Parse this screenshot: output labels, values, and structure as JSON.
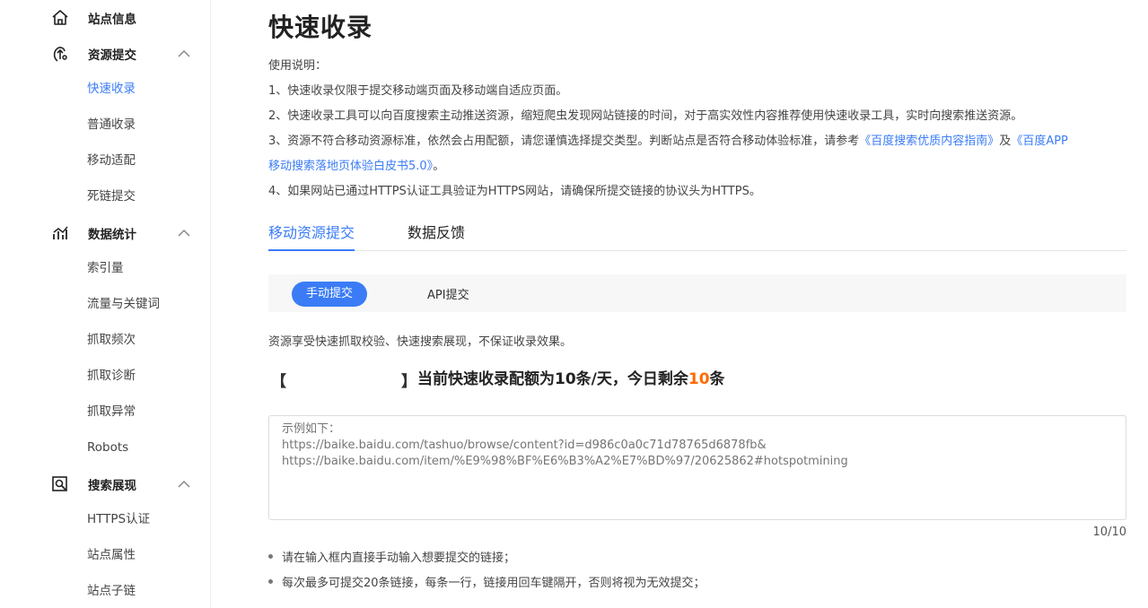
{
  "sidebar": {
    "sections": [
      {
        "label": "站点信息",
        "icon": "home-icon",
        "items": []
      },
      {
        "label": "资源提交",
        "icon": "resource-submit-icon",
        "items": [
          "快速收录",
          "普通收录",
          "移动适配",
          "死链提交"
        ]
      },
      {
        "label": "数据统计",
        "icon": "stats-icon",
        "items": [
          "索引量",
          "流量与关键词",
          "抓取频次",
          "抓取诊断",
          "抓取异常",
          "Robots"
        ]
      },
      {
        "label": "搜索展现",
        "icon": "search-display-icon",
        "items": [
          "HTTPS认证",
          "站点属性",
          "站点子链"
        ]
      }
    ]
  },
  "main": {
    "title": "快速收录",
    "instructions_label": "使用说明：",
    "line1": "1、快速收录仅限于提交移动端页面及移动端自适应页面。",
    "line2": "2、快速收录工具可以向百度搜索主动推送资源，缩短爬虫发现网站链接的时间，对于高实效性内容推荐使用快速收录工具，实时向搜索推送资源。",
    "line3_prefix": "3、资源不符合移动资源标准，依然会占用配额，请您谨慎选择提交类型。判断站点是否符合移动体验标准，请参考",
    "line3_link1": "《百度搜索优质内容指南》",
    "line3_and": "及",
    "line3_link2a": "《百度APP",
    "line3_link2b": "移动搜索落地页体验白皮书5.0》",
    "line3_end": "。",
    "line4": "4、如果网站已通过HTTPS认证工具验证为HTTPS网站，请确保所提交链接的协议头为HTTPS。",
    "tabs": [
      "移动资源提交",
      "数据反馈"
    ],
    "subtabs": [
      "手动提交",
      "API提交"
    ],
    "notice": "资源享受快速抓取校验、快速搜索展现，不保证收录效果。",
    "bracket_left": "【",
    "bracket_right": "】",
    "quota_prefix": "当前快速收录配额为10条/天，今日剩余",
    "quota_remaining": "10",
    "quota_suffix": "条",
    "textarea_placeholder": "示例如下：\nhttps://baike.baidu.com/tashuo/browse/content?id=d986c0a0c71d78765d6878fb&\nhttps://baike.baidu.com/item/%E9%98%BF%E6%B3%A2%E7%BD%97/20625862#hotspotmining",
    "counter": "10/10",
    "bullets": [
      "请在输入框内直接手动输入想要提交的链接；",
      "每次最多可提交20条链接，每条一行，链接用回车键隔开，否则将视为无效提交；"
    ]
  },
  "colors": {
    "accent": "#3b7cf6",
    "highlight": "#ff6a00"
  }
}
